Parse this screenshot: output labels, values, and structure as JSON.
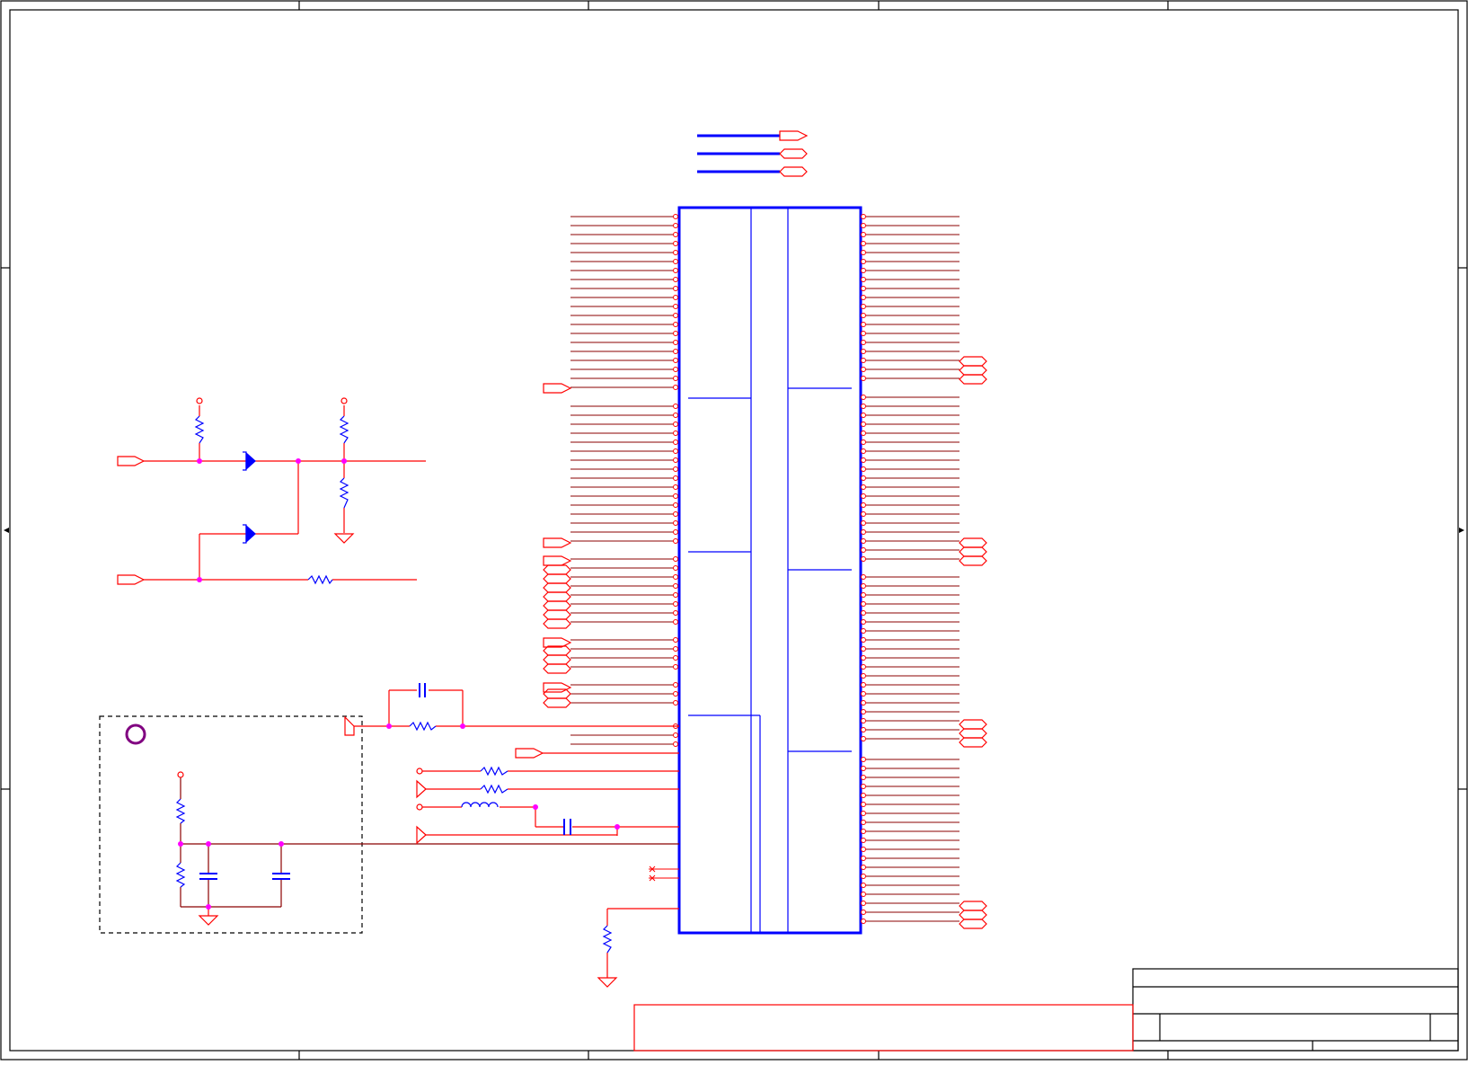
{
  "colors": {
    "background": "#ffffff",
    "border": "#000000",
    "net": "#ff0000",
    "pin": "#8b0000",
    "component": "#0000ff",
    "junction": "#ff00ff",
    "marker": "#800080",
    "subcircuit_outline": "#000000"
  },
  "icons": {
    "offpage_input": "pentagon-flag-icon",
    "offpage_bidirectional": "hexagon-flag-icon",
    "power_symbol": "circle-terminal-icon",
    "ground_symbol": "triangle-ground-icon",
    "resistor": "zigzag-resistor-icon",
    "capacitor": "parallel-plate-capacitor-icon",
    "inductor": "coil-inductor-icon",
    "diode": "zener-diode-icon",
    "reference_marker": "circle-marker-icon"
  },
  "schematic": {
    "main_ic": {
      "left_pin_rows": 56,
      "right_pin_rows": 80
    },
    "bus_outputs": 3,
    "bidirectional_flag_groups": 4,
    "title_block_text": []
  }
}
